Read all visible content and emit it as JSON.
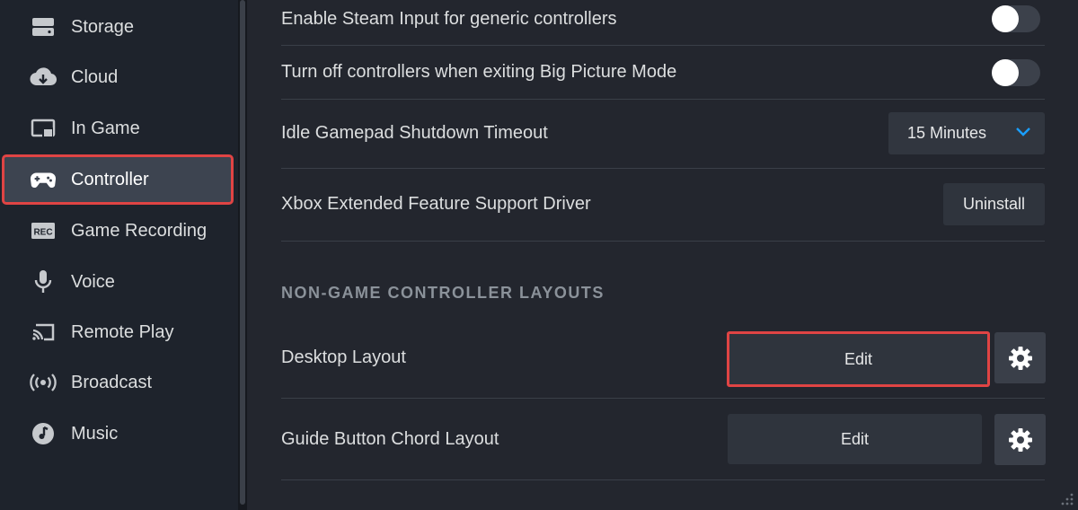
{
  "sidebar": {
    "items": [
      {
        "label": "Storage",
        "icon": "storage-icon"
      },
      {
        "label": "Cloud",
        "icon": "cloud-icon"
      },
      {
        "label": "In Game",
        "icon": "in-game-icon"
      },
      {
        "label": "Controller",
        "icon": "controller-icon",
        "active": true
      },
      {
        "label": "Game Recording",
        "icon": "rec-icon"
      },
      {
        "label": "Voice",
        "icon": "microphone-icon"
      },
      {
        "label": "Remote Play",
        "icon": "cast-icon"
      },
      {
        "label": "Broadcast",
        "icon": "broadcast-icon"
      },
      {
        "label": "Music",
        "icon": "music-icon"
      }
    ],
    "rec_badge": "REC"
  },
  "settings": {
    "steam_input_label": "Enable Steam Input for generic controllers",
    "steam_input_on": false,
    "turn_off_label": "Turn off controllers when exiting Big Picture Mode",
    "turn_off_on": false,
    "idle_label": "Idle Gamepad Shutdown Timeout",
    "idle_value": "15 Minutes",
    "xbox_label": "Xbox Extended Feature Support Driver",
    "uninstall_label": "Uninstall"
  },
  "layouts": {
    "section_title": "NON-GAME CONTROLLER LAYOUTS",
    "desktop_label": "Desktop Layout",
    "desktop_edit": "Edit",
    "guide_label": "Guide Button Chord Layout",
    "guide_edit": "Edit"
  },
  "colors": {
    "highlight": "#e04444",
    "accent": "#1a9fff",
    "background": "#23262e"
  }
}
